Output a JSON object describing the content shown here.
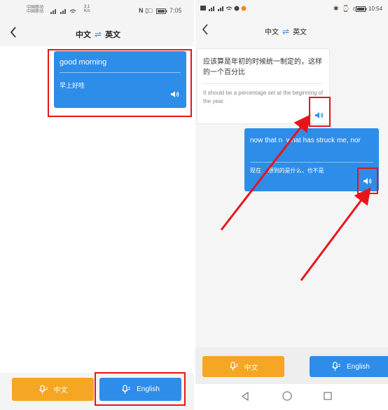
{
  "left": {
    "status": {
      "carrier1": "中国移动",
      "carrier2": "中国移动",
      "speed": "3.1\nK/s",
      "time": "7:05"
    },
    "nav": {
      "source": "中文",
      "swap": "⇌",
      "target": "英文"
    },
    "bubble": {
      "original": "good morning",
      "translation": "早上好哇"
    },
    "buttons": {
      "chinese": "中文",
      "english": "English"
    }
  },
  "right": {
    "status": {
      "time": "10:54"
    },
    "nav": {
      "source": "中文",
      "swap": "⇌",
      "target": "英文"
    },
    "bubble1": {
      "original": "应该算是年初的时候统一制定的，这样的一个百分比",
      "translation": "It should be a percentage set at the beginning of the year."
    },
    "bubble2": {
      "original": "now that n  what has struck me, nor",
      "translation": "现在  想到的是什么，也不是"
    },
    "buttons": {
      "chinese": "中文",
      "english": "English"
    }
  },
  "colors": {
    "blue": "#2e8de8",
    "orange": "#f5a623",
    "annotation_red": "#e8141c"
  },
  "icons": [
    "back-icon",
    "swap-icon",
    "speaker-icon",
    "microphone-icon",
    "nav-back-triangle-icon",
    "nav-home-circle-icon",
    "nav-recents-square-icon"
  ]
}
